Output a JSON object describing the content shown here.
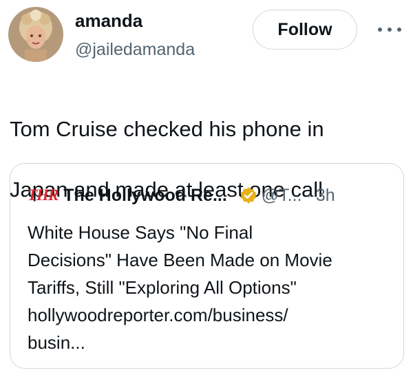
{
  "author": {
    "display_name": "amanda",
    "handle": "@jailedamanda",
    "avatar_icon": "profile-photo"
  },
  "actions": {
    "follow_label": "Follow",
    "more_icon": "more-horizontal-icon"
  },
  "tweet": {
    "text_lines": [
      "Tom Cruise checked his phone in",
      "Japan and made at least one call"
    ]
  },
  "quote": {
    "logo_text": "THR",
    "logo_color": "#d8262e",
    "display_name": "The Hollywood Re...",
    "verified_badge": "gold-verified-icon",
    "verified_color": "#e8b019",
    "handle": "@T...",
    "separator": "·",
    "time": "3h",
    "body_lines": [
      "White House Says \"No Final",
      "Decisions\" Have Been Made on Movie",
      "Tariffs, Still \"Exploring All Options\"",
      "hollywoodreporter.com/business/",
      "busin..."
    ]
  },
  "colors": {
    "text_primary": "#0f1419",
    "text_secondary": "#536471",
    "border": "#cfd9de"
  }
}
